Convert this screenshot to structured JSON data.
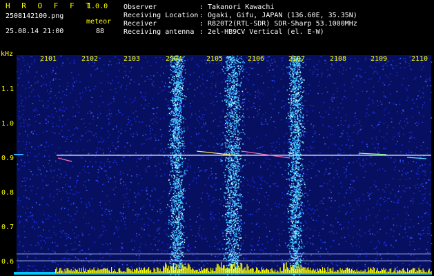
{
  "header": {
    "app_title": "H R O F F T",
    "version": "1.0.0",
    "filename": "2508142100.png",
    "datetime": "25.08.14 21:00",
    "detector_label": "meteor",
    "detector_count": "88",
    "fields": [
      {
        "label": "Observer",
        "value": ": Takanori Kawachi"
      },
      {
        "label": "Receiving Location",
        "value": ": Ogaki, Gifu, JAPAN (136.60E, 35.35N)"
      },
      {
        "label": "Receiver",
        "value": ": R820T2(RTL-SDR) SDR-Sharp 53.1000MHz"
      },
      {
        "label": "Receiving antenna",
        "value": ": 2el-HB9CV Vertical (el. E-W)"
      }
    ]
  },
  "axes": {
    "y_unit": "kHz",
    "x_ticks": [
      "2101",
      "2102",
      "2103",
      "2104",
      "2105",
      "2106",
      "2107",
      "2108",
      "2109",
      "2110"
    ],
    "y_ticks": [
      "1.1",
      "1.0",
      "0.9",
      "0.8",
      "0.7",
      "0.6"
    ]
  },
  "colors": {
    "background": "#000000",
    "text_yellow": "#ffff00",
    "text_white": "#ffffff",
    "noise_blue": "#1a2bd6",
    "band_cyan": "#2fb0ff",
    "carrier": "#e8f0ff",
    "signal_bar": "#ffff00",
    "signal_base": "#00c8ff"
  }
}
